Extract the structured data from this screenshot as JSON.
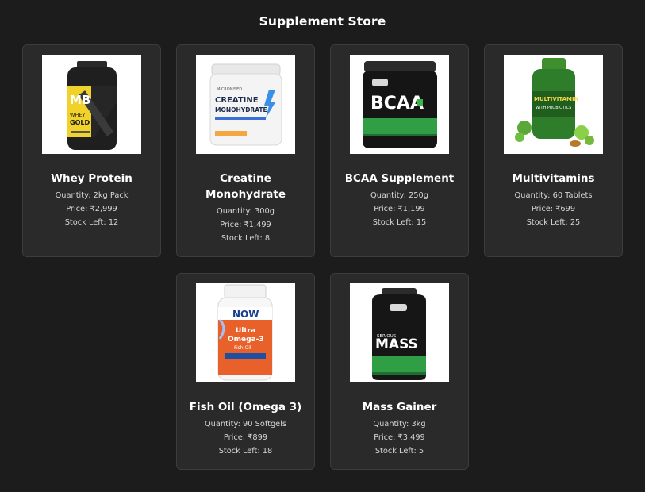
{
  "store": {
    "title": "Supplement Store",
    "quantity_label": "Quantity:",
    "price_label": "Price:",
    "stock_label": "Stock Left:"
  },
  "products": [
    {
      "name": "Whey Protein",
      "quantity": "2kg Pack",
      "price": "₹2,999",
      "stock": "12",
      "image_icon": "whey-protein-jar-icon",
      "package_text": [
        "MB",
        "WHEY",
        "GOLD"
      ]
    },
    {
      "name": "Creatine Monohydrate",
      "quantity": "300g",
      "price": "₹1,499",
      "stock": "8",
      "image_icon": "creatine-tub-icon",
      "package_text": [
        "MICRONISED",
        "CREATINE",
        "MONOHYDRATE"
      ]
    },
    {
      "name": "BCAA Supplement",
      "quantity": "250g",
      "price": "₹1,199",
      "stock": "15",
      "image_icon": "bcaa-tub-icon",
      "package_text": [
        "BCAA"
      ]
    },
    {
      "name": "Multivitamins",
      "quantity": "60 Tablets",
      "price": "₹699",
      "stock": "25",
      "image_icon": "multivitamin-bottle-icon",
      "package_text": [
        "MULTIVITAMIN",
        "WITH PROBIOTICS"
      ]
    },
    {
      "name": "Fish Oil (Omega 3)",
      "quantity": "90 Softgels",
      "price": "₹899",
      "stock": "18",
      "image_icon": "fish-oil-bottle-icon",
      "package_text": [
        "NOW",
        "Ultra",
        "Omega-3",
        "Fish Oil"
      ]
    },
    {
      "name": "Mass Gainer",
      "quantity": "3kg",
      "price": "₹3,499",
      "stock": "5",
      "image_icon": "mass-gainer-jar-icon",
      "package_text": [
        "SERIOUS",
        "MASS"
      ]
    }
  ]
}
